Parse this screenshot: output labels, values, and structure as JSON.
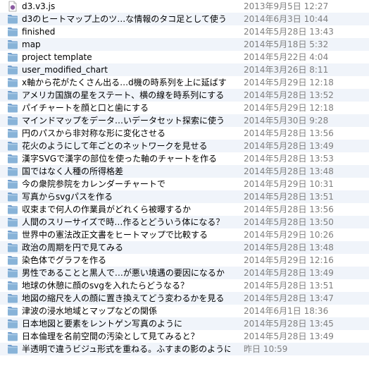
{
  "colors": {
    "folder_body": "#88b3d8",
    "folder_tab": "#6f9ccb",
    "row_alt": "#f0f4fa",
    "date_text": "#7f7f7f",
    "js_file_badge": "#8a5aa0"
  },
  "files": [
    {
      "name": "d3.v3.js",
      "modified": "2013年9月5日 12:27",
      "icon": "js-file-icon"
    },
    {
      "name": "d3のヒートマップ上のツ…な情報のタコ足として使う",
      "modified": "2014年6月3日 10:44",
      "icon": "folder-icon"
    },
    {
      "name": "finished",
      "modified": "2014年5月28日 13:43",
      "icon": "folder-icon"
    },
    {
      "name": "map",
      "modified": "2014年5月18日 5:32",
      "icon": "folder-icon"
    },
    {
      "name": "project template",
      "modified": "2014年5月22日 4:04",
      "icon": "folder-icon"
    },
    {
      "name": "user_modified_chart",
      "modified": "2014年3月26日 8:11",
      "icon": "folder-icon"
    },
    {
      "name": "x軸から花がたくさん出る…d機の時系列を上に延ばす",
      "modified": "2014年5月29日 12:18",
      "icon": "folder-icon"
    },
    {
      "name": "アメリカ国旗の星をステート、横の線を時系列にする",
      "modified": "2014年5月28日 13:52",
      "icon": "folder-icon"
    },
    {
      "name": "パイチャートを顔と口と歯にする",
      "modified": "2014年5月29日 12:18",
      "icon": "folder-icon"
    },
    {
      "name": "マインドマップをデータ…いデータセット探索に使う",
      "modified": "2014年5月30日 9:28",
      "icon": "folder-icon"
    },
    {
      "name": "円のパスから非対称な形に変化させる",
      "modified": "2014年5月28日 13:56",
      "icon": "folder-icon"
    },
    {
      "name": "花火のようにして年ごとのネットワークを見せる",
      "modified": "2014年5月28日 13:49",
      "icon": "folder-icon"
    },
    {
      "name": "漢字SVGで漢字の部位を使った軸のチャートを作る",
      "modified": "2014年5月28日 13:53",
      "icon": "folder-icon"
    },
    {
      "name": "国ではなく人種の所得格差",
      "modified": "2014年5月28日 13:48",
      "icon": "folder-icon"
    },
    {
      "name": "今の衆院参院をカレンダーチャートで",
      "modified": "2014年5月29日 10:31",
      "icon": "folder-icon"
    },
    {
      "name": "写真からsvgパスを作る",
      "modified": "2014年5月28日 13:51",
      "icon": "folder-icon"
    },
    {
      "name": "収束まで何人の作業員がどれくら被曝するか",
      "modified": "2014年5月28日 13:56",
      "icon": "folder-icon"
    },
    {
      "name": "人間のスリーサイズで時…作るとどういう体になる？",
      "modified": "2014年5月28日 13:50",
      "icon": "folder-icon"
    },
    {
      "name": "世界中の憲法改正文書をヒートマップで比較する",
      "modified": "2014年5月29日 10:26",
      "icon": "folder-icon"
    },
    {
      "name": "政治の周期を円で見てみる",
      "modified": "2014年5月28日 13:48",
      "icon": "folder-icon"
    },
    {
      "name": "染色体でグラフを作る",
      "modified": "2014年5月29日 12:16",
      "icon": "folder-icon"
    },
    {
      "name": "男性であることと黒人で…が悪い境遇の要因になるか",
      "modified": "2014年5月28日 13:49",
      "icon": "folder-icon"
    },
    {
      "name": "地球の休憩に顔のsvgを入れたらどうなる？",
      "modified": "2014年5月28日 13:51",
      "icon": "folder-icon"
    },
    {
      "name": "地図の縮尺を人の顔に置き換えてどう変わるかを見る",
      "modified": "2014年5月28日 13:47",
      "icon": "folder-icon"
    },
    {
      "name": "津波の浸水地域とマップなどの関係",
      "modified": "2014年6月1日 18:36",
      "icon": "folder-icon"
    },
    {
      "name": "日本地図と要素をレントゲン写真のように",
      "modified": "2014年5月28日 13:45",
      "icon": "folder-icon"
    },
    {
      "name": "日本倫理を名前空間の汚染として見てみると？",
      "modified": "2014年5月28日 13:49",
      "icon": "folder-icon"
    },
    {
      "name": "半透明で違うビジュ形式を重ねる。ふすまの影のように",
      "modified": "昨日 10:59",
      "icon": "folder-icon"
    }
  ]
}
